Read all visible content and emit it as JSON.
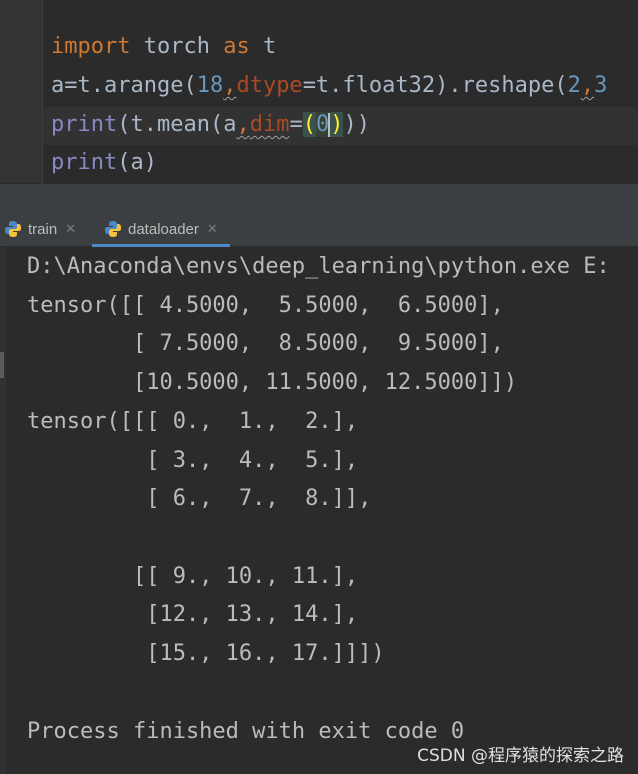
{
  "editor": {
    "lines": [
      {
        "import_kw": "import",
        "module": " torch ",
        "as_kw": "as",
        "alias": " t"
      },
      {
        "p1": "a",
        "p2": "=t.arange(",
        "num1": "18",
        "comma1": ",",
        "param": "dtype",
        "p3": "=t.float32).reshape(",
        "num2": "2",
        "comma2": ",",
        "num3": "3"
      },
      {
        "fn": "print",
        "p1": "(t.mean(",
        "var": "a",
        "comma": ",",
        "param": "dim",
        "eq": "=",
        "open": "(",
        "num": "0",
        "close": ")",
        "rest": "))"
      },
      {
        "fn": "print",
        "rest": "(a)"
      }
    ]
  },
  "run_tabs": [
    {
      "label": "train",
      "icon": "python-icon",
      "active": false
    },
    {
      "label": "dataloader",
      "icon": "python-icon",
      "active": true
    }
  ],
  "console": {
    "lines": [
      "D:\\Anaconda\\envs\\deep_learning\\python.exe E:",
      "tensor([[ 4.5000,  5.5000,  6.5000],",
      "        [ 7.5000,  8.5000,  9.5000],",
      "        [10.5000, 11.5000, 12.5000]])",
      "tensor([[[ 0.,  1.,  2.],",
      "         [ 3.,  4.,  5.],",
      "         [ 6.,  7.,  8.]],",
      "",
      "        [[ 9., 10., 11.],",
      "         [12., 13., 14.],",
      "         [15., 16., 17.]]])",
      "",
      "Process finished with exit code 0"
    ]
  },
  "watermark": "CSDN @程序猿的探索之路",
  "colors": {
    "background": "#2b2b2b",
    "keyword": "#cc7832",
    "number": "#6897bb",
    "parameter": "#aa4926",
    "builtin": "#8888c6",
    "text": "#a9b7c6",
    "active_tab_underline": "#4a88c7"
  }
}
